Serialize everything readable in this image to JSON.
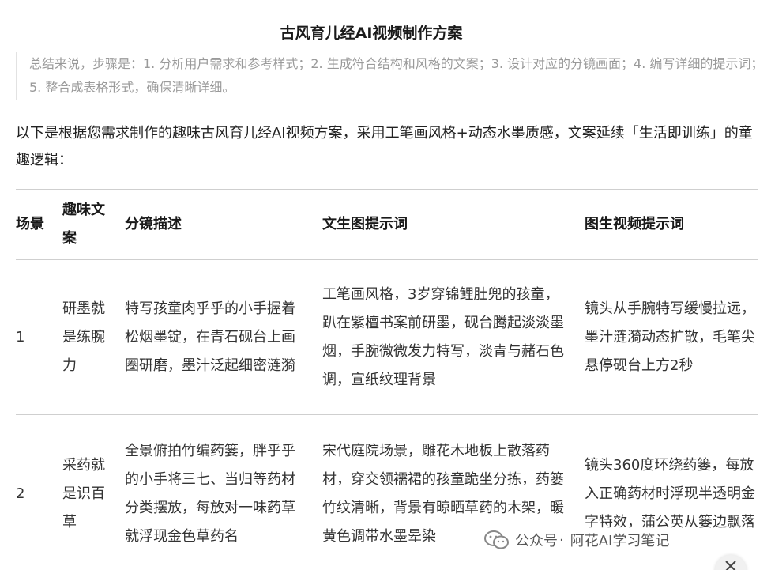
{
  "article": {
    "title": "古风育儿经AI视频制作方案",
    "summary": "总结来说，步骤是：1. 分析用户需求和参考样式；2. 生成符合结构和风格的文案；3. 设计对应的分镜画面；4. 编写详细的提示词；5. 整合成表格形式，确保清晰详细。",
    "intro": "以下是根据您需求制作的趣味古风育儿经AI视频方案，采用工笔画风格+动态水墨质感，文案延续「生活即训练」的童趣逻辑："
  },
  "table": {
    "headers": [
      "场景",
      "趣味文案",
      "分镜描述",
      "文生图提示词",
      "图生视频提示词"
    ],
    "rows": [
      {
        "scene": "1",
        "copy": "研墨就是练腕力",
        "storyboard": "特写孩童肉乎乎的小手握着松烟墨锭，在青石砚台上画圈研磨，墨汁泛起细密涟漪",
        "t2i": "工笔画风格，3岁穿锦鲤肚兜的孩童，趴在紫檀书案前研墨，砚台腾起淡淡墨烟，手腕微微发力特写，淡青与赭石色调，宣纸纹理背景",
        "i2v": "镜头从手腕特写缓慢拉远，墨汁涟漪动态扩散，毛笔尖悬停砚台上方2秒"
      },
      {
        "scene": "2",
        "copy": "采药就是识百草",
        "storyboard": "全景俯拍竹编药篓，胖乎乎的小手将三七、当归等药材分类摆放，每放对一味药草就浮现金色草药名",
        "t2i": "宋代庭院场景，雕花木地板上散落药材，穿交领襦裙的孩童跪坐分拣，药篓竹纹清晰，背景有晾晒草药的木架，暖黄色调带水墨晕染",
        "i2v": "镜头360度环绕药篓，每放入正确药材时浮现半透明金字特效，蒲公英从篓边飘落"
      }
    ]
  },
  "watermark": {
    "platform": "公众号",
    "account": "阿花AI学习笔记",
    "icon": "wechat-icon"
  },
  "close_icon": "close-icon"
}
